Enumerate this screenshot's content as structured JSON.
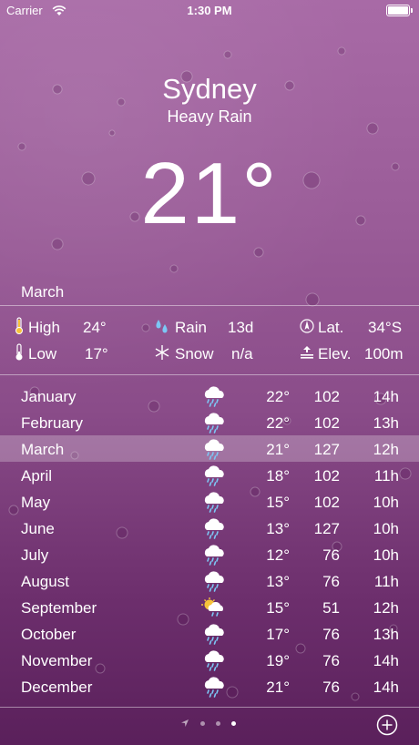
{
  "status": {
    "carrier": "Carrier",
    "time": "1:30 PM"
  },
  "location": {
    "city": "Sydney",
    "condition": "Heavy Rain",
    "temperature": "21°"
  },
  "selected_month": "March",
  "stats": {
    "high": {
      "label": "High",
      "value": "24°"
    },
    "low": {
      "label": "Low",
      "value": "17°"
    },
    "rain": {
      "label": "Rain",
      "value": "13d"
    },
    "snow": {
      "label": "Snow",
      "value": "n/a"
    },
    "lat": {
      "label": "Lat.",
      "value": "34°S"
    },
    "elev": {
      "label": "Elev.",
      "value": "100m"
    }
  },
  "months": [
    {
      "month": "January",
      "icon": "rain-cloud-icon",
      "temp": "22°",
      "rain": "102",
      "hours": "14h"
    },
    {
      "month": "February",
      "icon": "rain-cloud-icon",
      "temp": "22°",
      "rain": "102",
      "hours": "13h"
    },
    {
      "month": "March",
      "icon": "rain-cloud-icon",
      "temp": "21°",
      "rain": "127",
      "hours": "12h",
      "selected": true
    },
    {
      "month": "April",
      "icon": "rain-cloud-icon",
      "temp": "18°",
      "rain": "102",
      "hours": "11h"
    },
    {
      "month": "May",
      "icon": "rain-cloud-icon",
      "temp": "15°",
      "rain": "102",
      "hours": "10h"
    },
    {
      "month": "June",
      "icon": "rain-cloud-icon",
      "temp": "13°",
      "rain": "127",
      "hours": "10h"
    },
    {
      "month": "July",
      "icon": "rain-cloud-icon",
      "temp": "12°",
      "rain": "76",
      "hours": "10h"
    },
    {
      "month": "August",
      "icon": "rain-cloud-icon",
      "temp": "13°",
      "rain": "76",
      "hours": "11h"
    },
    {
      "month": "September",
      "icon": "sun-rain-icon",
      "temp": "15°",
      "rain": "51",
      "hours": "12h"
    },
    {
      "month": "October",
      "icon": "rain-cloud-icon",
      "temp": "17°",
      "rain": "76",
      "hours": "13h"
    },
    {
      "month": "November",
      "icon": "rain-cloud-icon",
      "temp": "19°",
      "rain": "76",
      "hours": "14h"
    },
    {
      "month": "December",
      "icon": "rain-cloud-icon",
      "temp": "21°",
      "rain": "76",
      "hours": "14h"
    }
  ],
  "page_indicator": {
    "pages": 3,
    "active": 3
  },
  "colors": {
    "background_top": "#a86aa6",
    "background_bottom": "#5a205b",
    "text": "#ffffff"
  }
}
